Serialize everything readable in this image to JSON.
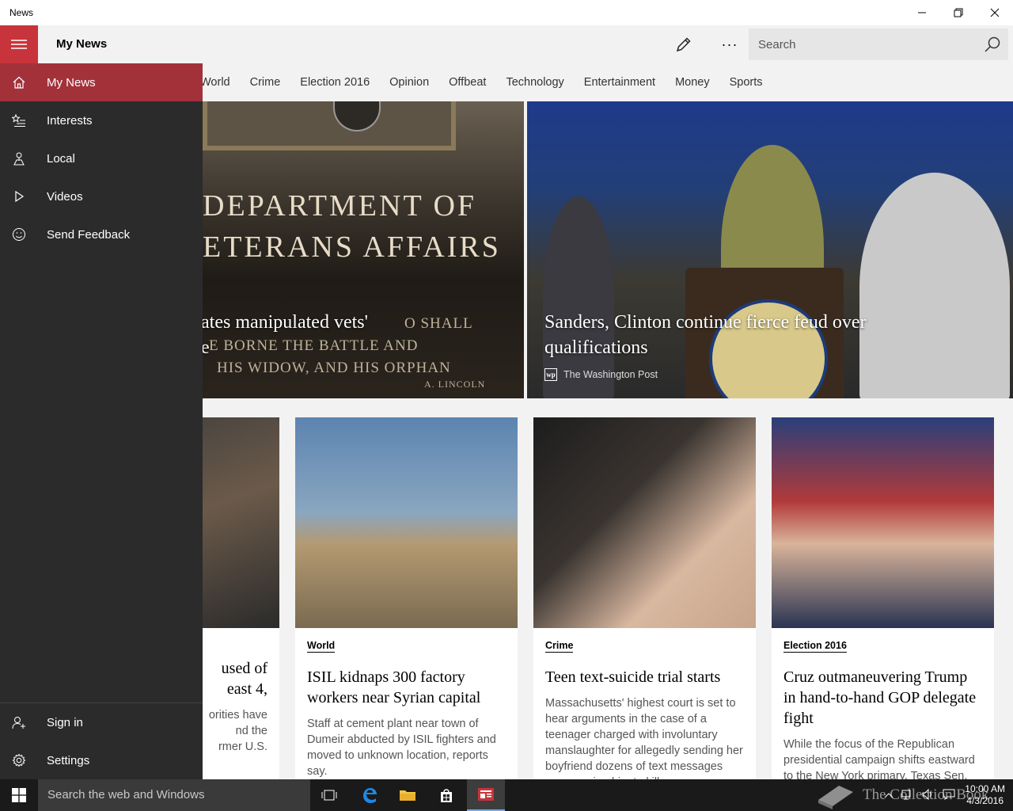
{
  "window": {
    "title": "News"
  },
  "header": {
    "app_title": "My News",
    "search_placeholder": "Search",
    "more_label": "···"
  },
  "categories": [
    "World",
    "Crime",
    "Election 2016",
    "Opinion",
    "Offbeat",
    "Technology",
    "Entertainment",
    "Money",
    "Sports"
  ],
  "nav": {
    "items": [
      {
        "label": "My News",
        "icon": "home-icon",
        "active": true
      },
      {
        "label": "Interests",
        "icon": "star-list-icon"
      },
      {
        "label": "Local",
        "icon": "local-icon"
      },
      {
        "label": "Videos",
        "icon": "play-icon"
      },
      {
        "label": "Send Feedback",
        "icon": "smiley-icon"
      }
    ],
    "bottom": [
      {
        "label": "Sign in",
        "icon": "person-add-icon"
      },
      {
        "label": "Settings",
        "icon": "gear-icon"
      }
    ]
  },
  "hero": {
    "left": {
      "headline_line1": "ates manipulated vets'",
      "headline_line2": "e",
      "plaque_line1": "DEPARTMENT OF",
      "plaque_line2": "ETERANS AFFAIRS",
      "inscription_line1": "O SHALL",
      "inscription_line2": "E BORNE THE BATTLE AND",
      "inscription_line3": "HIS WIDOW, AND HIS ORPHAN",
      "inscription_sig": "A. LINCOLN"
    },
    "right": {
      "headline": "Sanders, Clinton continue fierce feud over qualifications",
      "source": "The Washington Post",
      "source_logo": "wp"
    }
  },
  "cards": [
    {
      "tag": "",
      "title": "used of\neast 4,",
      "desc": "orities have\nnd the\nrmer U.S."
    },
    {
      "tag": "World",
      "title": "ISIL kidnaps 300 factory workers near Syrian capital",
      "desc": "Staff at cement plant near town of Dumeir abducted by ISIL fighters and moved to unknown location, reports say."
    },
    {
      "tag": "Crime",
      "title": "Teen text-suicide trial starts",
      "desc": "Massachusetts' highest court is set to hear arguments in the case of a teenager charged with involuntary manslaughter for allegedly sending her boyfriend dozens of text messages encouraging him to kill"
    },
    {
      "tag": "Election 2016",
      "title": "Cruz outmaneuvering Trump in hand-to-hand GOP delegate fight",
      "desc": "While the focus of the Republican presidential campaign shifts eastward to the New York primary, Texas Sen."
    }
  ],
  "taskbar": {
    "search_placeholder": "Search the web and Windows",
    "time": "10:00 AM",
    "date": "4/3/2016",
    "watermark": "The Collection Book"
  },
  "colors": {
    "accent": "#c8343b",
    "nav_active": "#a3313a",
    "drawer_bg": "#2b2b2b"
  }
}
